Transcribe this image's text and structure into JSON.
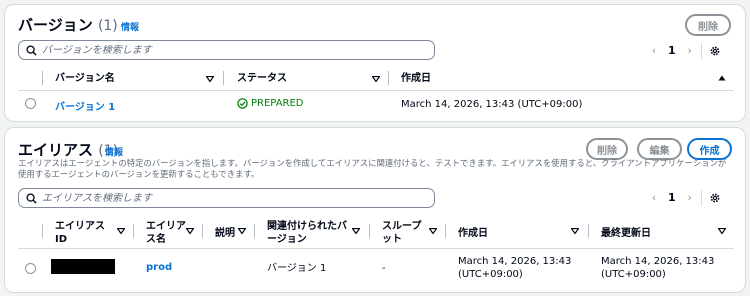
{
  "versions": {
    "title": "バージョン",
    "count": "(1)",
    "info": "情報",
    "delete_label": "削除",
    "search_placeholder": "バージョンを検索します",
    "page": "1",
    "columns": [
      "バージョン名",
      "ステータス",
      "作成日"
    ],
    "rows": [
      {
        "name": "バージョン 1",
        "status": "PREPARED",
        "created": "March 14, 2026, 13:43 (UTC+09:00)"
      }
    ]
  },
  "aliases": {
    "title": "エイリアス",
    "count": "(1)",
    "info": "情報",
    "delete_label": "削除",
    "edit_label": "編集",
    "create_label": "作成",
    "description": "エイリアスはエージェントの特定のバージョンを指します。バージョンを作成してエイリアスに関連付けると、テストできます。エイリアスを使用すると、クライアントアプリケーションが使用するエージェントのバージョンを更新することもできます。",
    "search_placeholder": "エイリアスを検索します",
    "page": "1",
    "columns": {
      "alias_id_1": "エイリアス",
      "alias_id_2": "ID",
      "alias_name_1": "エイリア",
      "alias_name_2": "ス名",
      "description": "説明",
      "linked_version_1": "関連付けられたバ",
      "linked_version_2": "ージョン",
      "throughput_1": "スループ",
      "throughput_2": "ット",
      "created": "作成日",
      "updated": "最終更新日"
    },
    "rows": [
      {
        "alias_name": "prod",
        "linked_version": "バージョン 1",
        "throughput": "-",
        "created_1": "March 14, 2026, 13:43",
        "created_2": "(UTC+09:00)",
        "updated_1": "March 14, 2026, 13:43",
        "updated_2": "(UTC+09:00)"
      }
    ]
  },
  "colors": {
    "link": "#0972d3",
    "success": "#037f0c",
    "border": "#d5dbdb",
    "disabled": "#8d9399"
  }
}
